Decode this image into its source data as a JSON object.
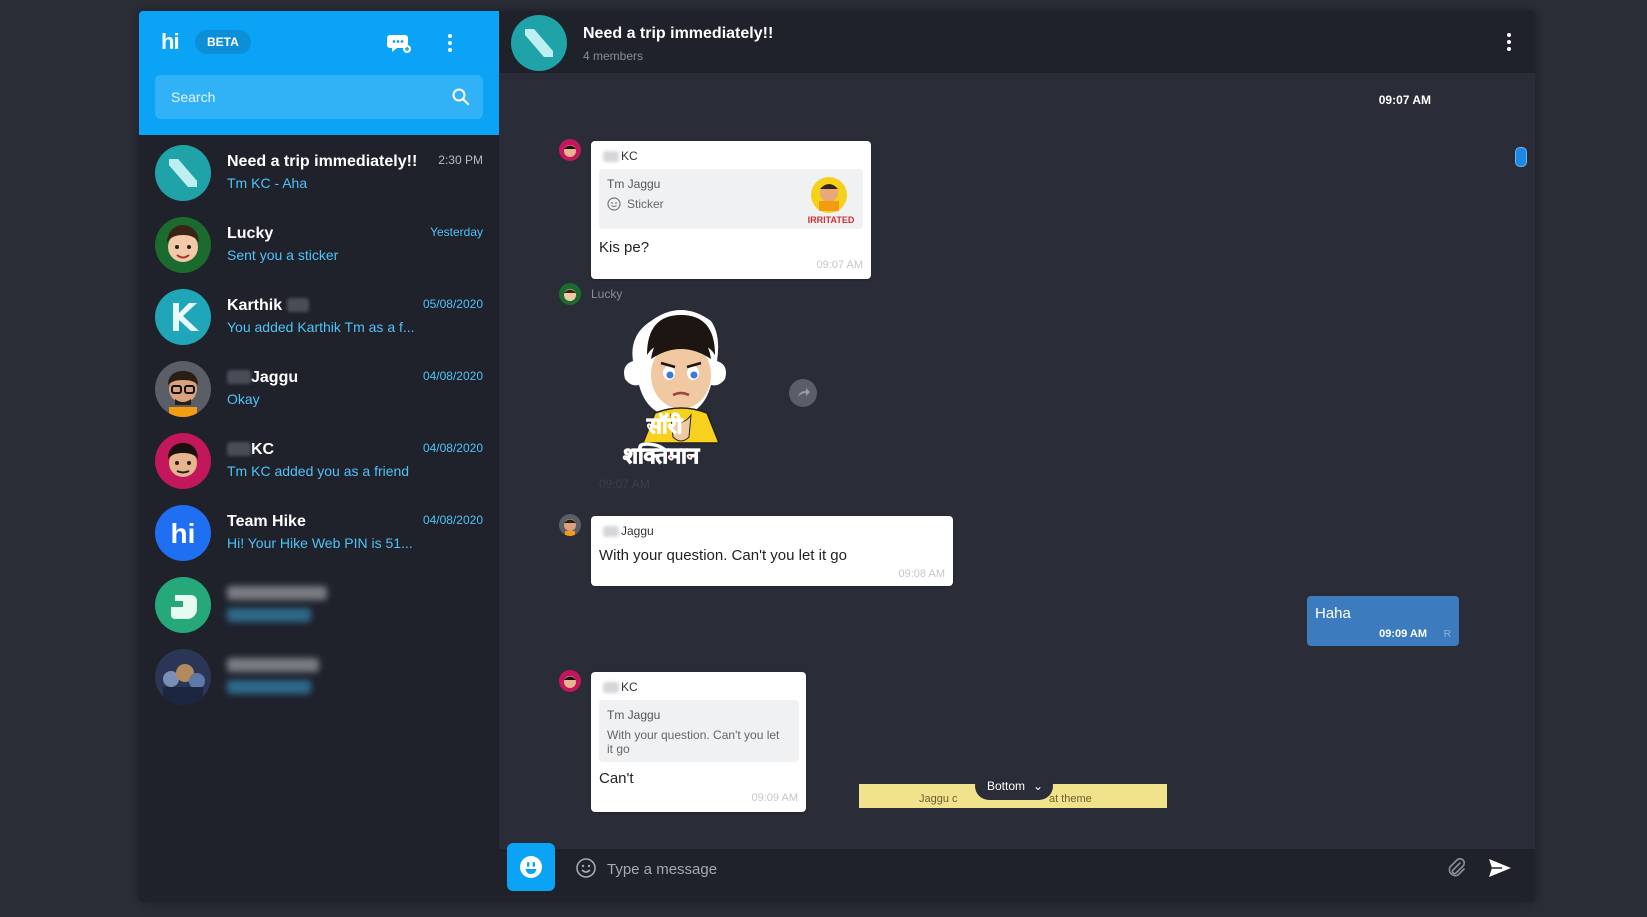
{
  "sidebar": {
    "logo": "hi",
    "beta": "BETA",
    "new_chat_icon": "new-chat-icon",
    "menu_icon": "more-vertical-icon",
    "search": {
      "placeholder": "Search",
      "icon": "search-icon"
    },
    "chats": [
      {
        "name": "Need a trip immediately!!",
        "preview": "Tm KC - Aha",
        "time": "2:30 PM"
      },
      {
        "name": "Lucky",
        "preview": "Sent you a sticker",
        "time": "Yesterday"
      },
      {
        "name": "Karthik",
        "preview": "You added Karthik Tm as a f...",
        "time": "05/08/2020"
      },
      {
        "name": "Jaggu",
        "preview": "Okay",
        "time": "04/08/2020"
      },
      {
        "name": "KC",
        "preview": "Tm KC added you as a friend",
        "time": "04/08/2020"
      },
      {
        "name": "Team Hike",
        "preview": "Hi! Your Hike Web PIN is 51...",
        "time": "04/08/2020"
      }
    ]
  },
  "conversation": {
    "title": "Need a trip immediately!!",
    "members": "4 members",
    "top_time": "09:07 AM",
    "messages": [
      {
        "sender": "KC",
        "quote_name": "Tm Jaggu",
        "quote_text": "Sticker",
        "sticker_caption": "IRRITATED",
        "text": "Kis pe?",
        "time": "09:07 AM"
      },
      {
        "sender": "Lucky",
        "sticker_text_line1": "सॉरी",
        "sticker_text_line2": "शक्तिमान",
        "time": "09:07 AM"
      },
      {
        "sender": "Jaggu",
        "text": "With your question. Can't you let it go",
        "time": "09:08 AM"
      },
      {
        "sender": "You",
        "text": "Haha",
        "time": "09:09 AM",
        "status": "R"
      },
      {
        "sender": "KC",
        "quote_name": "Tm Jaggu",
        "quote_text": "With your question. Can't you let it go",
        "text": "Can't",
        "time": "09:09 AM"
      }
    ],
    "notice_left": "Jaggu c",
    "notice_right": "at theme",
    "bottom_button": "Bottom"
  },
  "composer": {
    "placeholder": "Type a message"
  },
  "colors": {
    "accent": "#0aa3f5",
    "outgoing": "#3d7bbf",
    "preview": "#4fc3f7"
  }
}
